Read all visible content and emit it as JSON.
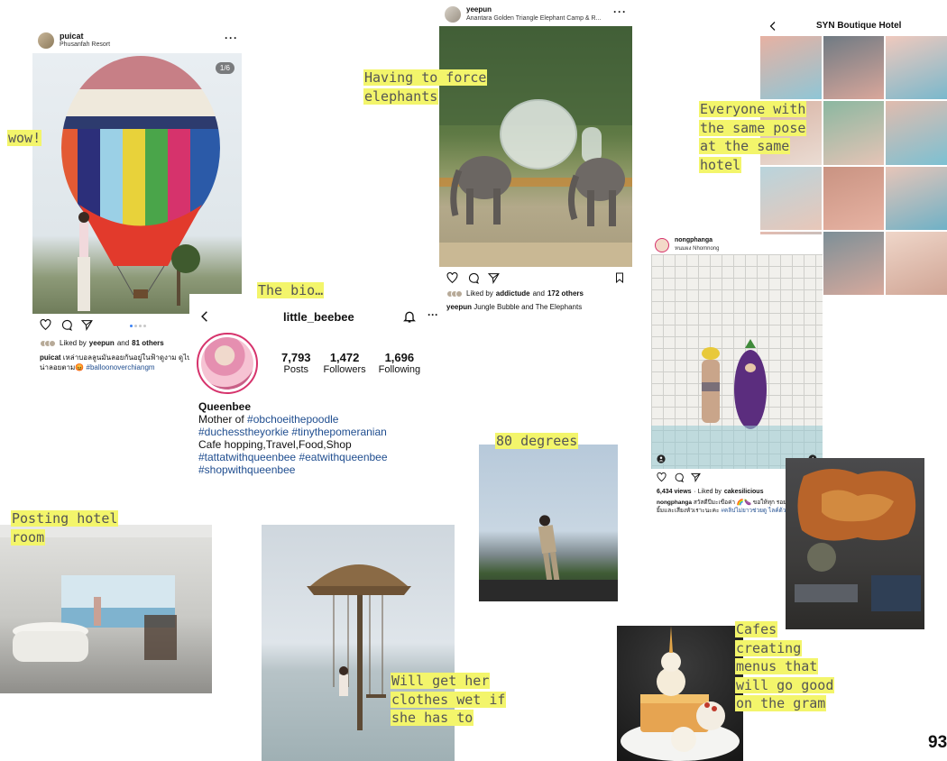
{
  "post_puicat": {
    "username": "puicat",
    "location": "Phusanfah Resort",
    "counter": "1/6",
    "liked_prefix": "Liked by",
    "liked_user": "yeepun",
    "liked_and": "and",
    "liked_others": "81 others",
    "caption_user": "puicat",
    "caption_text": "เหล่าบอลลูนมันลอยกันอยู่ในฟ้าดูงาม ดูไปก็น่าลอยตาม😡",
    "caption_tag": "#balloonoverchiangm"
  },
  "post_yeepun": {
    "username": "yeepun",
    "location": "Anantara Golden Triangle Elephant Camp & R...",
    "liked_prefix": "Liked by",
    "liked_user": "addictude",
    "liked_and": "and",
    "liked_others": "172 others",
    "caption_user": "yeepun",
    "caption_text": "Jungle Bubble and The Elephants"
  },
  "hotel_grid": {
    "title": "SYN Boutique Hotel"
  },
  "post_nongphanga": {
    "username": "nongphanga",
    "location": "หนมผง Nhomnong",
    "views": "6,434 views",
    "liked_prefix": "· Liked by",
    "liked_user": "cakesilicious",
    "caption_user": "nongphanga",
    "caption_text": "สวัสดีปีมะเขือค่า 🌈🍆 ขอให้ทุก รอยยิ้มและเสียงหัวเราะนะคะ",
    "caption_tag": "#คลิปไม่ยาวช่วยดู",
    "caption_end": "ไลค์ด้วย"
  },
  "profile": {
    "username": "little_beebee",
    "stats": [
      {
        "num": "7,793",
        "label": "Posts"
      },
      {
        "num": "1,472",
        "label": "Followers"
      },
      {
        "num": "1,696",
        "label": "Following"
      }
    ],
    "name": "Queenbee",
    "bio_prefix": "Mother of",
    "bio_tag1": "#obchoeithepoodle",
    "bio_tag2": "#duchesstheyorkie",
    "bio_tag3": "#tinythepomeranian",
    "bio_line": "Cafe hopping,Travel,Food,Shop",
    "bio_tag4": "#tattatwithqueenbee",
    "bio_tag5": "#eatwithqueenbee",
    "bio_tag6": "#shopwithqueenbee"
  },
  "notes": {
    "wow": "wow!",
    "elephants": "Having to force elephants",
    "pose": "Everyone with the same pose at the same hotel",
    "bio": "The bio…",
    "degrees": "80 degrees",
    "hotel_room": "Posting hotel room",
    "wet": "Will get her clothes wet if she has to",
    "cafes": "Cafes creating menus that will go good on the gram"
  },
  "page_number": "93",
  "colors": {
    "highlight": "#f3f56b",
    "hashtag": "#1f4d8f",
    "story_ring": "#d6336c"
  }
}
